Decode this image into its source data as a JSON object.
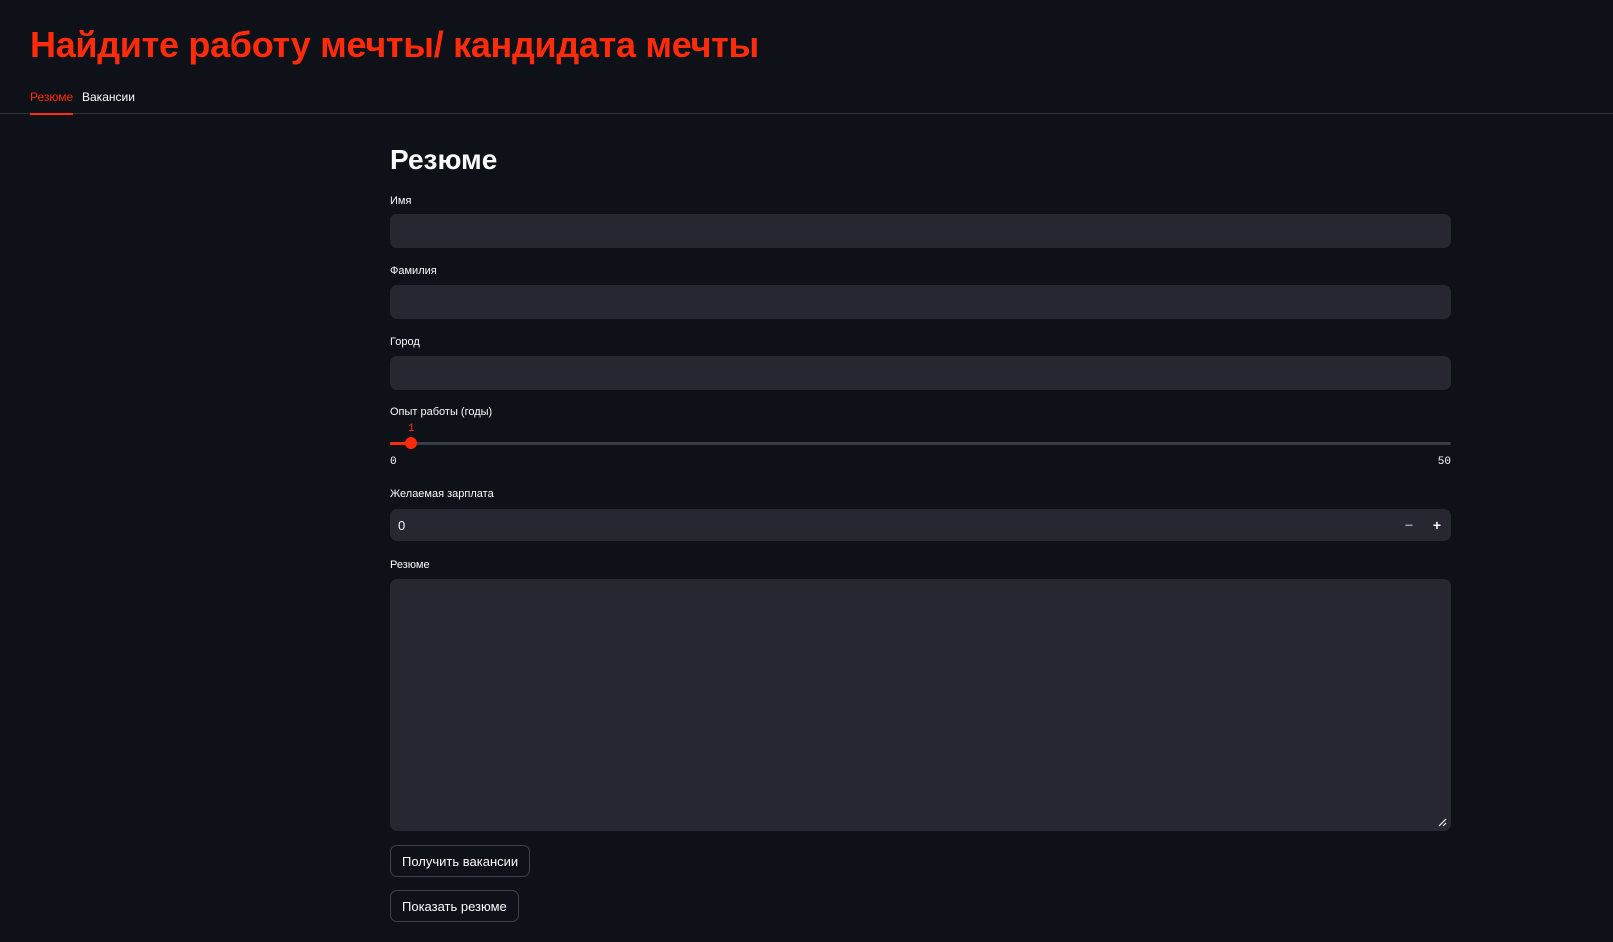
{
  "header": {
    "title": "Найдите работу мечты/ кандидата мечты"
  },
  "tabs": [
    {
      "label": "Резюме",
      "active": true
    },
    {
      "label": "Вакансии",
      "active": false
    }
  ],
  "form": {
    "section_title": "Резюме",
    "name": {
      "label": "Имя",
      "value": ""
    },
    "surname": {
      "label": "Фамилия",
      "value": ""
    },
    "city": {
      "label": "Город",
      "value": ""
    },
    "experience": {
      "label": "Опыт работы (годы)",
      "value": "1",
      "min": "0",
      "max": "50"
    },
    "salary": {
      "label": "Желаемая зарплата",
      "value": "0",
      "minus": "−",
      "plus": "+"
    },
    "resume": {
      "label": "Резюме",
      "value": ""
    },
    "buttons": {
      "get_vacancies": "Получить вакансии",
      "show_resume": "Показать резюме"
    }
  },
  "colors": {
    "accent": "#ff2b0a",
    "background": "#0e1117",
    "input_bg": "#262730"
  }
}
